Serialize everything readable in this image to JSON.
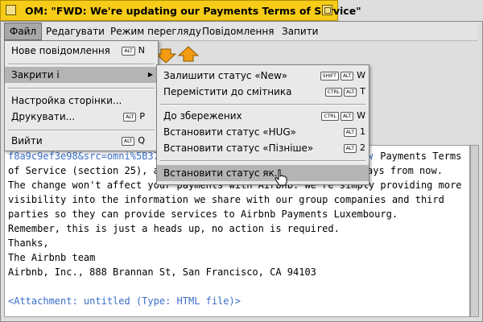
{
  "window": {
    "title": "OM: \"FWD: We're updating our Payments Terms of Service\""
  },
  "menubar": [
    {
      "label": "Файл",
      "active": true
    },
    {
      "label": "Редагувати"
    },
    {
      "label": "Режим перегляду"
    },
    {
      "label": "Повідомлення"
    },
    {
      "label": "Запити"
    }
  ],
  "file_menu": {
    "items": [
      {
        "label": "Нове повідомлення",
        "mod": "ALT",
        "key": "N"
      },
      {
        "label": "Закрити і",
        "submenu": true
      },
      {
        "label": "Настройка сторінки..."
      },
      {
        "label": "Друкувати...",
        "mod": "ALT",
        "key": "P"
      },
      {
        "label": "Вийти",
        "mod": "ALT",
        "key": "Q"
      }
    ]
  },
  "close_submenu": {
    "items": [
      {
        "label": "Залишити статус «New»",
        "mod1": "SHIFT",
        "mod2": "ALT",
        "key": "W"
      },
      {
        "label": "Перемістити до смітника",
        "mod1": "CTRL",
        "mod2": "ALT",
        "key": "T"
      },
      {
        "label": "До збережених",
        "mod1": "CTRL",
        "mod2": "ALT",
        "key": "W"
      },
      {
        "label": "Встановити статус «HUG»",
        "mod2": "ALT",
        "key": "1"
      },
      {
        "label": "Встановити статус «Пізніше»",
        "mod2": "ALT",
        "key": "2"
      },
      {
        "label": "Встановити статус як..."
      }
    ]
  },
  "body_lines": [
    {
      "text": "f8a9c9ef3e98&src=omni%5B37",
      "blue": true
    },
    {
      "text": "w",
      "blue": true
    },
    {
      "text": " Payments Terms"
    },
    {
      "text": "of Service (section 25), a"
    },
    {
      "text": "ays from now."
    },
    {
      "text": "The change won't affect your payments with Airbnb. We're simply providing more"
    },
    {
      "text": "visibility into the information we share with our group companies and third"
    },
    {
      "text": "parties so they can provide services to Airbnb Payments Luxembourg."
    },
    {
      "text": "Remember, this is just a heads up, no action is required."
    },
    {
      "text": "Thanks,"
    },
    {
      "text": "The Airbnb team"
    },
    {
      "text": "Airbnb, Inc., 888 Brannan St, San Francisco, CA 94103"
    },
    {
      "text": "<Attachment: untitled (Type: HTML file)>",
      "blue": true
    }
  ],
  "colors": {
    "titlebar": "#f7cc18",
    "link": "#3a6ec9",
    "arrow": "#f39c12"
  }
}
